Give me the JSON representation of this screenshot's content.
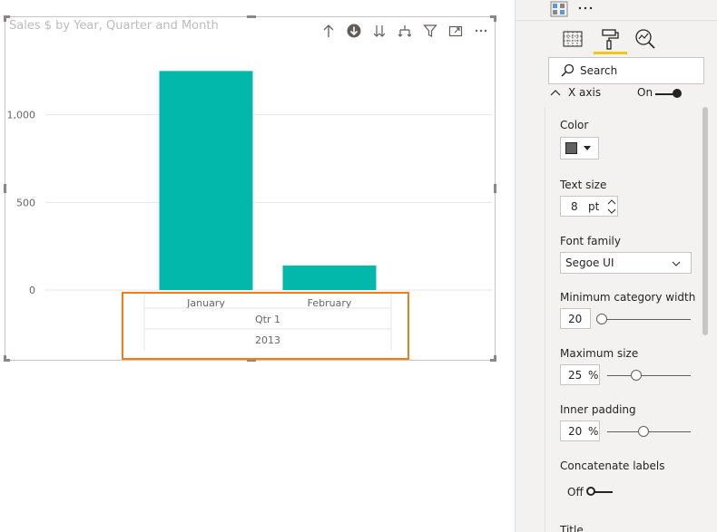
{
  "visual": {
    "title": "Sales $ by Year, Quarter and Month",
    "header_icons": [
      "drill-up-icon",
      "drill-down-icon",
      "expand-next-level-icon",
      "expand-hierarchy-icon",
      "filter-icon",
      "focus-mode-icon",
      "more-options-icon"
    ]
  },
  "chart_data": {
    "type": "bar",
    "categories": [
      "January",
      "February"
    ],
    "values": [
      1250,
      140
    ],
    "y_ticks": [
      "0",
      "500",
      "1,000"
    ],
    "ylim": [
      0,
      1350
    ],
    "x_axis_levels": [
      "Qtr 1",
      "2013"
    ],
    "bar_color": "#01b8aa",
    "grid": true
  },
  "pane": {
    "section_title": "X axis",
    "section_toggle": "On",
    "search_placeholder": "Search",
    "color_label": "Color",
    "color_value": "#616161",
    "text_size_label": "Text size",
    "text_size_value": "8",
    "text_size_unit": "pt",
    "font_family_label": "Font family",
    "font_family_value": "Segoe UI",
    "min_cat_width_label": "Minimum category width",
    "min_cat_width_value": "20",
    "max_size_label": "Maximum size",
    "max_size_value": "25",
    "max_size_unit": "%",
    "inner_padding_label": "Inner padding",
    "inner_padding_value": "20",
    "inner_padding_unit": "%",
    "concat_label": "Concatenate labels",
    "concat_toggle": "Off",
    "next_section_label": "Title",
    "sliders": {
      "min_cat_width": 0.0,
      "max_size": 0.32,
      "inner_padding": 0.42
    }
  },
  "highlight_color": "#f07c1a"
}
